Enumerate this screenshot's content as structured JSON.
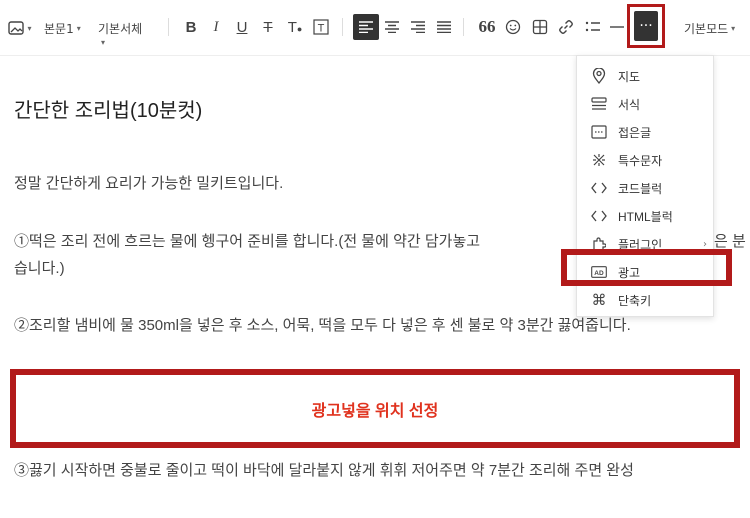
{
  "toolbar": {
    "paragraph_style": "본문1",
    "font_family": "기본서체",
    "mode": "기본모드",
    "more_label": "···"
  },
  "document": {
    "title": "간단한 조리법(10분컷)",
    "paragraphs": [
      "정말 간단하게 요리가 가능한 밀키트입니다.",
      "①떡은 조리 전에 흐르는 물에 헹구어 준비를 합니다.(전 물에 약간 담가놓고",
      "습니다.)",
      "②조리할 냄비에 물 350ml을 넣은 후 소스, 어묵, 떡을 모두 다 넣은 후 센 불로 약 3분간 끓여줍니다.",
      "③끓기 시작하면 중불로 줄이고 떡이 바닥에 달라붙지 않게 휘휘 저어주면 약 7분간 조리해 주면 완성"
    ],
    "para1_tail": "은 분",
    "ad_placeholder": "광고넣을 위치 선정"
  },
  "menu": {
    "items": [
      {
        "label": "지도",
        "icon": "map-pin-icon"
      },
      {
        "label": "서식",
        "icon": "template-icon"
      },
      {
        "label": "접은글",
        "icon": "fold-icon"
      },
      {
        "label": "특수문자",
        "icon": "special-char-icon"
      },
      {
        "label": "코드블럭",
        "icon": "code-icon"
      },
      {
        "label": "HTML블럭",
        "icon": "html-icon"
      },
      {
        "label": "플러그인",
        "icon": "plugin-icon"
      },
      {
        "label": "광고",
        "icon": "ad-icon"
      },
      {
        "label": "단축키",
        "icon": "shortcut-icon"
      }
    ]
  },
  "colors": {
    "highlight": "#b21a1a",
    "ad_text": "#e0321e"
  }
}
